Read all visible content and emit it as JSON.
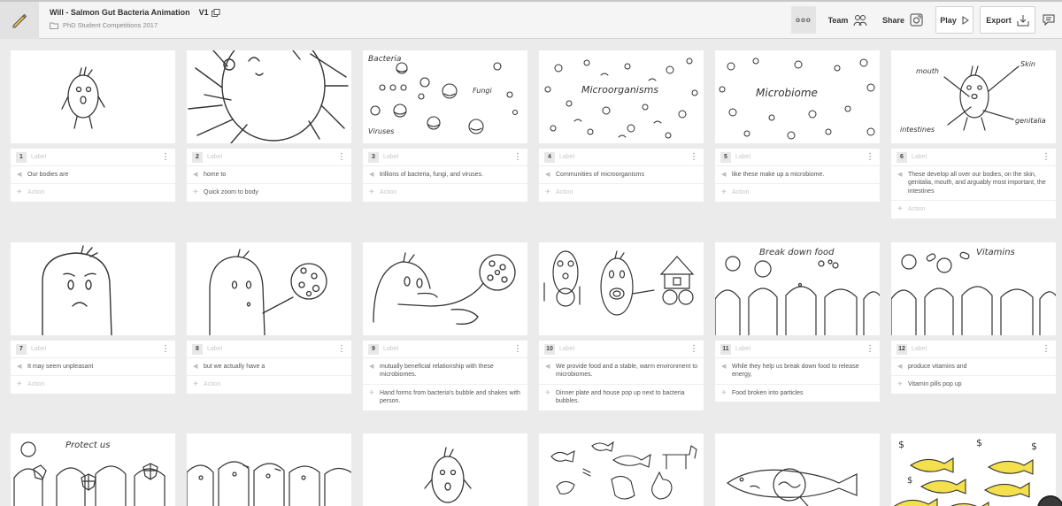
{
  "header": {
    "project_title": "Will - Salmon Gut Bacteria Animation",
    "version": "V1",
    "folder": "PhD Student Competitions 2017",
    "more_label": "ooo",
    "team_label": "Team",
    "share_label": "Share",
    "play_label": "Play",
    "export_label": "Export"
  },
  "label_placeholder": "Label",
  "action_placeholder": "Action",
  "frames": [
    {
      "num": "1",
      "dialogue": "Our bodies are",
      "action": ""
    },
    {
      "num": "2",
      "dialogue": "home to",
      "action": "Quick zoom to body"
    },
    {
      "num": "3",
      "dialogue": "trillions of bacteria, fungi, and viruses.",
      "action": ""
    },
    {
      "num": "4",
      "dialogue": "Communities of microorganisms",
      "action": ""
    },
    {
      "num": "5",
      "dialogue": "like these make up a microbiome.",
      "action": ""
    },
    {
      "num": "6",
      "dialogue": "These develop all over our bodies, on the skin, genitalia, mouth, and arguably most important, the intestines",
      "action": ""
    },
    {
      "num": "7",
      "dialogue": "It may seem unpleasant",
      "action": ""
    },
    {
      "num": "8",
      "dialogue": "but we actually have a",
      "action": ""
    },
    {
      "num": "9",
      "dialogue": "mutually beneficial relationship with these microbiomes.",
      "action": "Hand forms from bacteria's bubble and shakes with person."
    },
    {
      "num": "10",
      "dialogue": "We provide food and a stable, warm environment to microbiomes.",
      "action": "Dinner plate and house pop up next to bacteria bubbles."
    },
    {
      "num": "11",
      "dialogue": "While they help us break down food to release energy,",
      "action": "Food broken into particles"
    },
    {
      "num": "12",
      "dialogue": "produce vitamins and",
      "action": "Vitamin pills pop up"
    }
  ],
  "sketch_text": {
    "f3_bacteria": "Bacteria",
    "f3_fungi": "Fungi",
    "f3_viruses": "Viruses",
    "f4_micro": "Microorganisms",
    "f5_micro": "Microbiome",
    "f6_mouth": "mouth",
    "f6_skin": "Skin",
    "f6_intestines": "intestines",
    "f6_genitalia": "genitalia",
    "f11_text": "Break down food",
    "f12_text": "Vitamins",
    "f13_text": "Protect us"
  },
  "colors": {
    "fish_yellow": "#f4e04d",
    "accent_gold": "#c9a227"
  }
}
